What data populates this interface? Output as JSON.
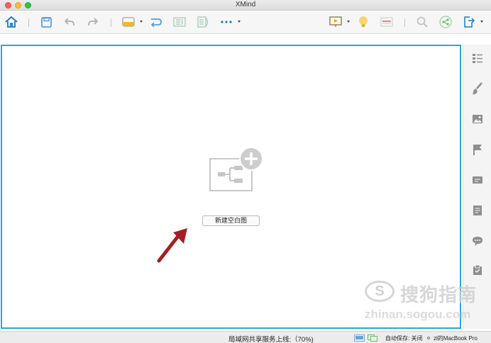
{
  "window": {
    "title": "XMind"
  },
  "toolbar": {
    "icons": [
      "home-icon",
      "save-icon",
      "undo-icon",
      "redo-icon",
      "theme-icon",
      "relationship-icon",
      "summary-icon",
      "boundary-icon",
      "more-icon",
      "presentation-icon",
      "idea-icon",
      "outline-icon",
      "search-icon",
      "share-icon",
      "export-icon"
    ]
  },
  "canvas": {
    "new_blank_label": "新建空白图",
    "border_color": "#29a7de",
    "arrow_color": "#a31f25"
  },
  "sidebar": {
    "icons": [
      "outline-list-icon",
      "format-brush-icon",
      "image-icon",
      "marker-flag-icon",
      "label-icon",
      "notes-icon",
      "comment-icon",
      "task-icon"
    ]
  },
  "status": {
    "lan_share": "局域网共享服务上线:（70%)",
    "autosave": "自动保存: 关闭",
    "host": "zl的MacBook Pro"
  },
  "watermark": {
    "logo": "S",
    "text": "搜狗指南",
    "url": "zhinan.sogou.com"
  }
}
